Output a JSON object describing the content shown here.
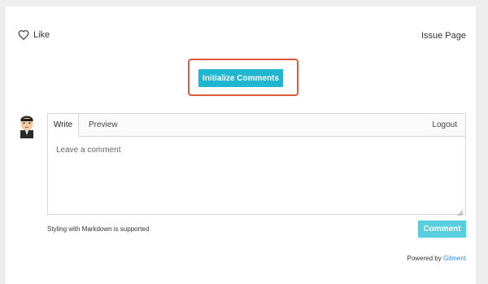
{
  "header": {
    "like_label": "Like",
    "issue_link": "Issue Page"
  },
  "init": {
    "button_label": "Initialize Comments",
    "highlight_color": "#e05a3c",
    "button_color": "#20b6cf"
  },
  "editor": {
    "tabs": [
      {
        "label": "Write"
      },
      {
        "label": "Preview"
      }
    ],
    "logout_label": "Logout",
    "placeholder": "Leave a comment"
  },
  "footer": {
    "markdown_note": "Styling with Markdown is supported",
    "comment_button": "Comment",
    "powered_by": "Powered by",
    "powered_link": "Gitment",
    "comment_button_color": "#58cfdf",
    "link_color": "#2b8ad6"
  },
  "icons": {
    "like": "heart-icon",
    "avatar": "avatar",
    "resize": "resize-grip-icon"
  }
}
